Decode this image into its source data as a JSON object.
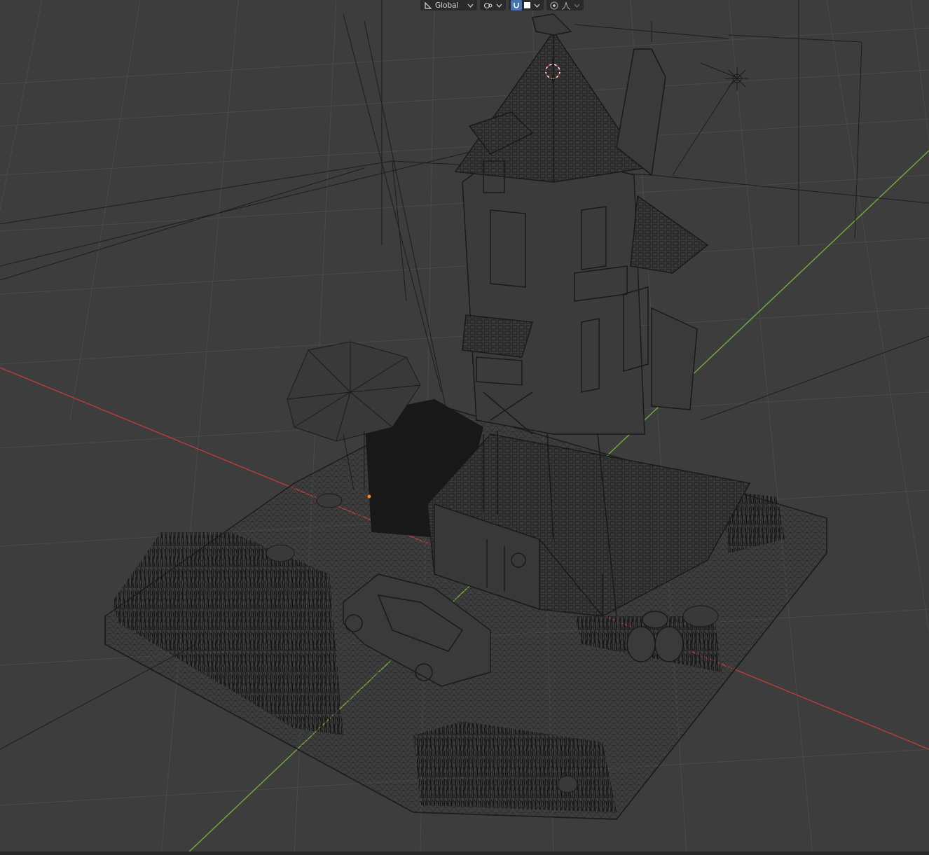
{
  "header": {
    "orientation_icon": "transform-orientation-icon",
    "orientation_label": "Global",
    "pivot_icon": "pivot-point-icon",
    "snap_icon": "snap-magnet-icon",
    "snap_target_icon": "snap-increment-icon",
    "proportional_icon": "proportional-editing-icon",
    "falloff_icon": "falloff-curve-icon"
  },
  "viewport": {
    "shading": "wireframe",
    "background_color": "#3d3d3d",
    "grid_color": "#4a4a4a",
    "x_axis_color": "#b43c3c",
    "y_axis_color": "#6ea83a"
  }
}
